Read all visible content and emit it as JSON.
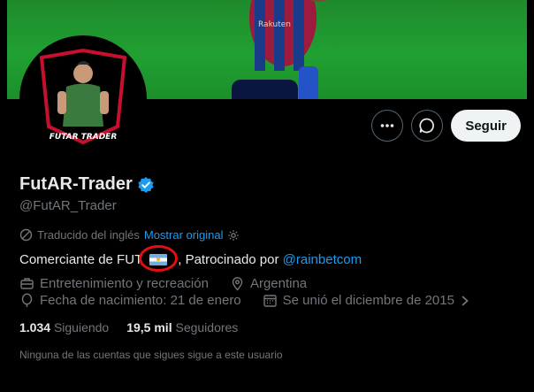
{
  "banner": {
    "background": "#21a032"
  },
  "avatar": {
    "text": "FUTAR TRADER"
  },
  "actions": {
    "more_icon": "more-horizontal-icon",
    "message_icon": "message-icon",
    "follow_label": "Seguir"
  },
  "profile": {
    "display_name": "FutAR-Trader",
    "verified_icon": "verified-badge-icon",
    "handle": "@FutAR_Trader"
  },
  "translation": {
    "label": "Traducido del inglés",
    "link": "Mostrar original"
  },
  "bio": {
    "prefix": "Comerciante de FU",
    "middle": "T",
    "flag": "Argentina flag",
    "suffix": ", Patrocinado por ",
    "mention": "@rainbetcom"
  },
  "meta": {
    "category": "Entretenimiento y recreación",
    "location": "Argentina",
    "birthday": "Fecha de nacimiento: 21 de enero",
    "joined": "Se unió el diciembre de 2015"
  },
  "stats": {
    "following_count": "1.034",
    "following_label": "Siguiendo",
    "followers_count": "19,5 mil",
    "followers_label": "Seguidores"
  },
  "followers_you_know": "Ninguna de las cuentas que sigues sigue a este usuario",
  "colors": {
    "accent": "#1d9bf0",
    "muted": "#71767b",
    "highlight_circle": "#e01010"
  }
}
